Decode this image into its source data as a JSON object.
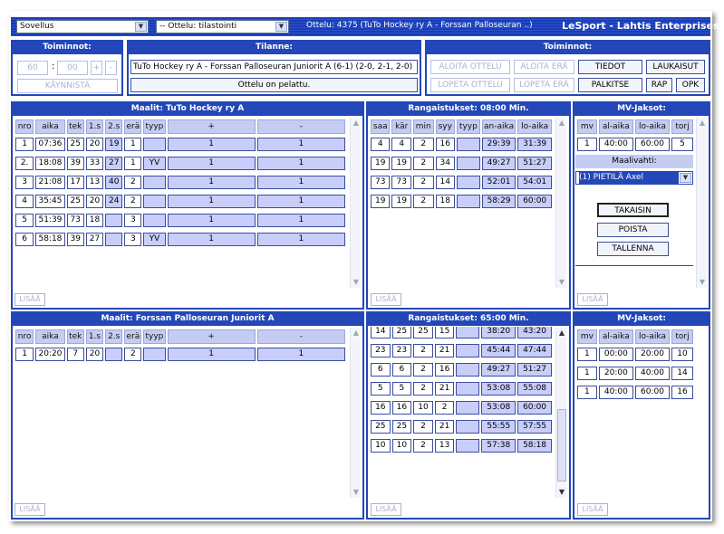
{
  "topbar": {
    "app_select": "Sovellus",
    "match_select": "-- Ottelu: tilastointi",
    "match_title": "Ottelu: 4375 (TuTo Hockey ry A - Forssan Palloseuran ..)",
    "brand": "LeSport - Lahtis Enterprises"
  },
  "toiminnot_left": {
    "title": "Toiminnot:",
    "min": "60",
    "colon": ":",
    "sec": "00",
    "plus": "+",
    "minus": "-",
    "start": "KÄYNNISTÄ"
  },
  "tilanne": {
    "title": "Tilanne:",
    "score_text": "TuTo Hockey ry A - Forssan Palloseuran Juniorit A (6-1) (2-0, 2-1, 2-0)",
    "status": "Ottelu on pelattu."
  },
  "toiminnot_right": {
    "title": "Toiminnot:",
    "aloita_ottelu": "ALOITA OTTELU",
    "aloita_era": "ALOITA ERÄ",
    "tiedot": "TIEDOT",
    "laukaisut": "LAUKAISUT",
    "lopeta_ottelu": "LOPETA OTTELU",
    "lopeta_era": "LOPETA ERÄ",
    "palkitse": "PALKITSE",
    "rap": "RAP",
    "opk": "OPK"
  },
  "goals_home": {
    "title": "Maalit: TuTo Hockey ry A",
    "headers": [
      "nro",
      "aika",
      "tek",
      "1.s",
      "2.s",
      "erä",
      "tyyp",
      "+",
      "-"
    ],
    "rows": [
      [
        "1",
        "07:36",
        "25",
        "20",
        "19",
        "1",
        "",
        "1",
        "1"
      ],
      [
        "2.",
        "18:08",
        "39",
        "33",
        "27",
        "1",
        "YV",
        "1",
        "1"
      ],
      [
        "3",
        "21:08",
        "17",
        "13",
        "40",
        "2",
        "",
        "1",
        "1"
      ],
      [
        "4",
        "35:45",
        "25",
        "20",
        "24",
        "2",
        "",
        "1",
        "1"
      ],
      [
        "5",
        "51:39",
        "73",
        "18",
        "",
        "3",
        "",
        "1",
        "1"
      ],
      [
        "6",
        "58:18",
        "39",
        "27",
        "",
        "3",
        "YV",
        "1",
        "1"
      ]
    ],
    "add": "LISÄÄ"
  },
  "penalties_home": {
    "title": "Rangaistukset: 08:00 Min.",
    "headers": [
      "saa",
      "kär",
      "min",
      "syy",
      "tyyp",
      "an-aika",
      "lo-aika"
    ],
    "rows": [
      [
        "4",
        "4",
        "2",
        "16",
        "",
        "29:39",
        "31:39"
      ],
      [
        "19",
        "19",
        "2",
        "34",
        "",
        "49:27",
        "51:27"
      ],
      [
        "73",
        "73",
        "2",
        "14",
        "",
        "52:01",
        "54:01"
      ],
      [
        "19",
        "19",
        "2",
        "18",
        "",
        "58:29",
        "60:00"
      ]
    ],
    "add": "LISÄÄ"
  },
  "mv_home": {
    "title": "MV-Jaksot:",
    "headers": [
      "mv",
      "al-aika",
      "lo-aika",
      "torj"
    ],
    "rows": [
      [
        "1",
        "40:00",
        "60:00",
        "5"
      ]
    ],
    "goalie_label": "Maalivahti:",
    "goalie_value": "(1) PIETILÄ Axel",
    "takaisin": "TAKAISIN",
    "poista": "POISTA",
    "tallenna": "TALLENNA",
    "add": "LISÄÄ"
  },
  "goals_away": {
    "title": "Maalit: Forssan Palloseuran Juniorit A",
    "headers": [
      "nro",
      "aika",
      "tek",
      "1.s",
      "2.s",
      "erä",
      "tyyp",
      "+",
      "-"
    ],
    "rows": [
      [
        "1",
        "20:20",
        "7",
        "20",
        "",
        "2",
        "",
        "1",
        "1"
      ]
    ],
    "add": "LISÄÄ"
  },
  "penalties_away": {
    "title": "Rangaistukset: 65:00 Min.",
    "rows": [
      [
        "14",
        "25",
        "25",
        "15",
        "",
        "38:20",
        "43:20"
      ],
      [
        "23",
        "23",
        "2",
        "21",
        "",
        "45:44",
        "47:44"
      ],
      [
        "6",
        "6",
        "2",
        "16",
        "",
        "49:27",
        "51:27"
      ],
      [
        "5",
        "5",
        "2",
        "21",
        "",
        "53:08",
        "55:08"
      ],
      [
        "16",
        "16",
        "10",
        "2",
        "",
        "53:08",
        "60:00"
      ],
      [
        "25",
        "25",
        "2",
        "21",
        "",
        "55:55",
        "57:55"
      ],
      [
        "10",
        "10",
        "2",
        "13",
        "",
        "57:38",
        "58:18"
      ]
    ],
    "add": "LISÄÄ"
  },
  "mv_away": {
    "title": "MV-Jaksot:",
    "headers": [
      "mv",
      "al-aika",
      "lo-aika",
      "torj"
    ],
    "rows": [
      [
        "1",
        "00:00",
        "20:00",
        "10"
      ],
      [
        "1",
        "20:00",
        "40:00",
        "14"
      ],
      [
        "1",
        "40:00",
        "60:00",
        "16"
      ]
    ],
    "add": "LISÄÄ"
  },
  "icons": {
    "dropdown": "chevron-down-icon",
    "scroll_up": "arrow-up-icon",
    "scroll_down": "arrow-down-icon"
  }
}
